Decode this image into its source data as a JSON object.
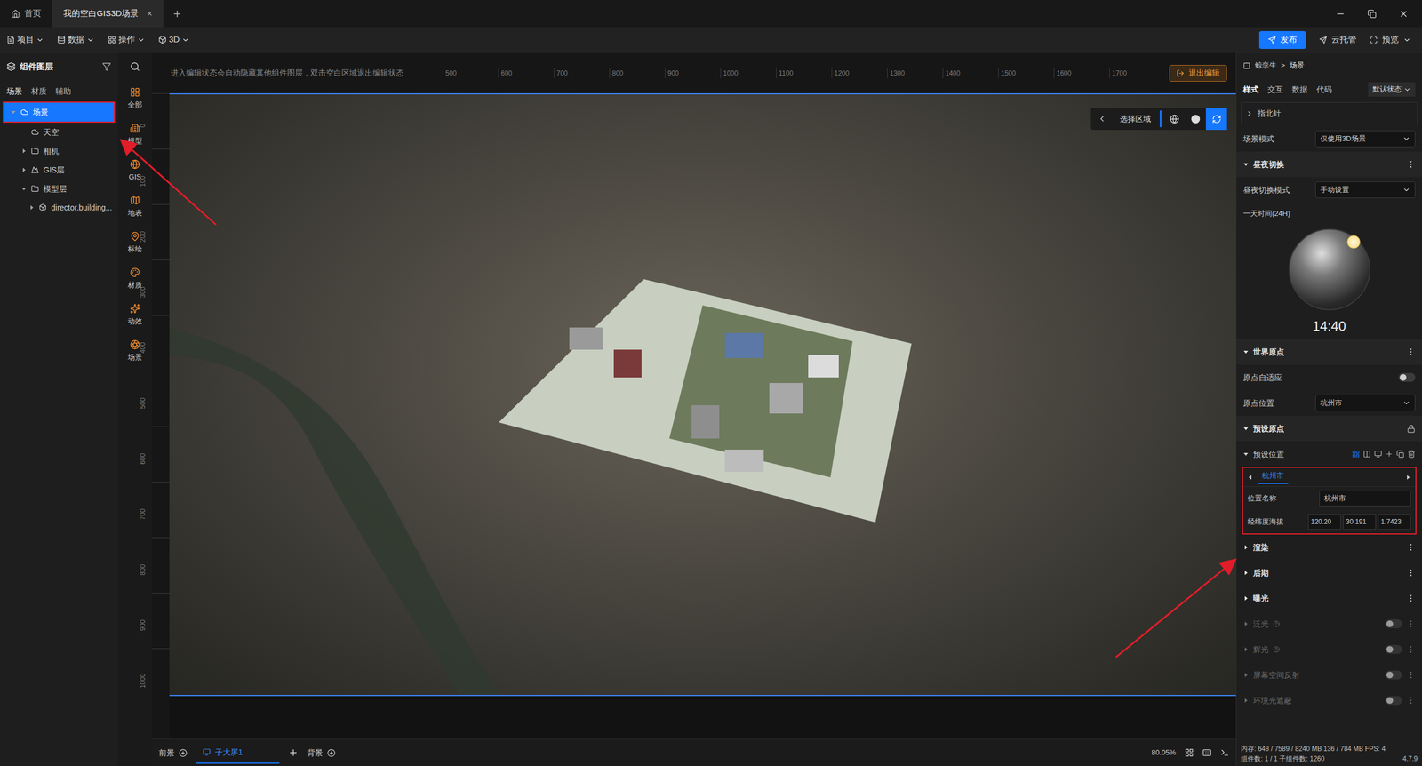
{
  "window": {
    "tabs": [
      {
        "label": "首页",
        "kind": "home",
        "selected": false,
        "close": ""
      },
      {
        "label": "我的空白GIS3D场景",
        "kind": "document",
        "selected": true,
        "close": "×"
      }
    ]
  },
  "toolbar": {
    "menus": [
      "项目",
      "数据",
      "操作",
      "3D"
    ],
    "publish": "发布",
    "cloud": "云托管",
    "preview": "预览"
  },
  "layers_panel": {
    "title": "组件图层",
    "tabs": [
      {
        "label": "场景",
        "selected": true
      },
      {
        "label": "材质",
        "selected": false
      },
      {
        "label": "辅助",
        "selected": false
      }
    ],
    "tree": [
      {
        "label": "场景",
        "kind": "scene",
        "depth": 0,
        "has_children": true,
        "expanded": true,
        "selected": true
      },
      {
        "label": "天空",
        "kind": "sky",
        "depth": 1,
        "has_children": false,
        "expanded": false,
        "selected": false
      },
      {
        "label": "相机",
        "kind": "folder",
        "depth": 1,
        "has_children": true,
        "expanded": false,
        "selected": false
      },
      {
        "label": "GIS层",
        "kind": "gis",
        "depth": 1,
        "has_children": true,
        "expanded": false,
        "selected": false
      },
      {
        "label": "模型层",
        "kind": "folder",
        "depth": 1,
        "has_children": true,
        "expanded": true,
        "selected": false
      },
      {
        "label": "director.building...",
        "kind": "model",
        "depth": 2,
        "has_children": true,
        "expanded": false,
        "selected": false
      }
    ]
  },
  "categories": [
    "全部",
    "模型",
    "GIS",
    "地表",
    "标绘",
    "材质",
    "动效",
    "场景"
  ],
  "canvas": {
    "hint": "进入编辑状态会自动隐藏其他组件图层，双击空白区域退出编辑状态",
    "ruler_top": [
      "500",
      "600",
      "700",
      "800",
      "900",
      "1000",
      "1100",
      "1200",
      "1300",
      "1400",
      "1500",
      "1600",
      "1700"
    ],
    "ruler_left": [
      "0",
      "100",
      "200",
      "300",
      "400",
      "500",
      "600",
      "700",
      "800",
      "900",
      "1000"
    ],
    "exit_button": "退出编辑",
    "viewport_toolbar": {
      "label": "选择区域",
      "modes": [
        {
          "selected": false
        },
        {
          "selected": false
        },
        {
          "selected": true
        }
      ]
    }
  },
  "bottom_bar": {
    "foreground": "前景",
    "screens": [
      {
        "label": "子大屏1",
        "selected": true
      }
    ],
    "background": "背景",
    "zoom": "80.05%"
  },
  "properties": {
    "breadcrumb": [
      "鲸孪生",
      "场景"
    ],
    "separator": ">",
    "tabs": [
      {
        "label": "样式",
        "selected": true
      },
      {
        "label": "交互",
        "selected": false
      },
      {
        "label": "数据",
        "selected": false
      },
      {
        "label": "代码",
        "selected": false
      }
    ],
    "state_select": "默认状态",
    "compass": "指北针",
    "scene_mode": {
      "label": "场景模式",
      "value": "仅使用3D场景"
    },
    "day_night": {
      "title": "昼夜切换",
      "expanded": true,
      "mode": {
        "label": "昼夜切换模式",
        "value": "手动设置"
      },
      "time_label": "一天时间(24H)",
      "time": "14:40"
    },
    "world_origin": {
      "title": "世界原点",
      "expanded": true,
      "auto": {
        "label": "原点自适应",
        "on": false
      },
      "position": {
        "label": "原点位置",
        "value": "杭州市"
      }
    },
    "preset_origin": {
      "title": "预设原点",
      "expanded": true,
      "locked": true,
      "preset_label": "预设位置",
      "preset_expanded": true,
      "tools": [
        {
          "selected": true
        },
        {
          "selected": false
        },
        {
          "selected": false
        }
      ],
      "tabs": [
        {
          "label": "杭州市",
          "selected": true
        }
      ],
      "name": {
        "label": "位置名称",
        "value": "杭州市"
      },
      "coords": {
        "label": "经纬度海拔",
        "values": [
          "120.20",
          "30.191",
          "1.7423"
        ]
      }
    },
    "sections": [
      {
        "label": "渲染",
        "kind": "menu",
        "disabled": false,
        "help": false,
        "on": false
      },
      {
        "label": "后期",
        "kind": "menu",
        "disabled": false,
        "help": false,
        "on": false
      },
      {
        "label": "曝光",
        "kind": "menu",
        "disabled": false,
        "help": false,
        "on": false
      },
      {
        "label": "泛光",
        "kind": "toggle",
        "disabled": true,
        "help": true,
        "on": false
      },
      {
        "label": "辉光",
        "kind": "toggle",
        "disabled": true,
        "help": true,
        "on": false
      },
      {
        "label": "屏幕空间反射",
        "kind": "toggle",
        "disabled": true,
        "help": false,
        "on": false
      },
      {
        "label": "环境光遮蔽",
        "kind": "toggle",
        "disabled": true,
        "help": false,
        "on": false
      }
    ],
    "status": [
      "内存: 648 / 7589 / 8240 MB 136 / 784 MB FPS: 4",
      "组件数: 1 / 1 子组件数: 1260"
    ],
    "version": "4.7.9"
  }
}
